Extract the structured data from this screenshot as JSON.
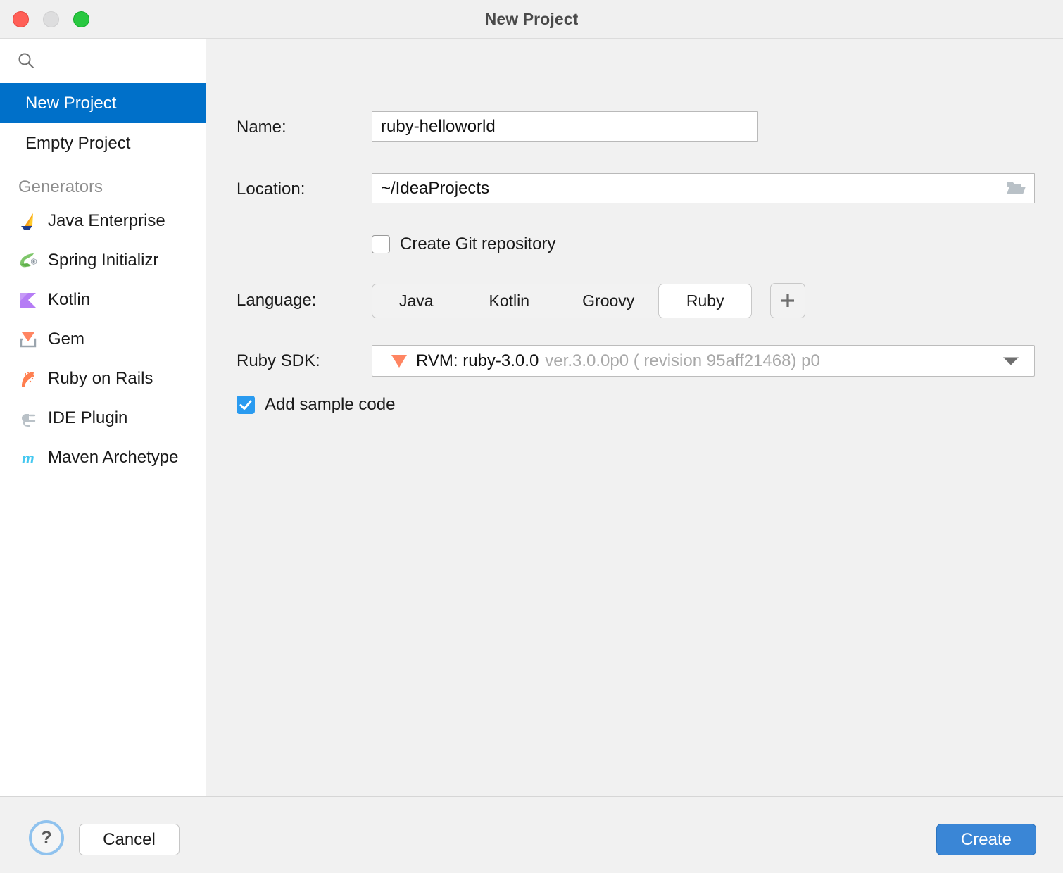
{
  "window": {
    "title": "New Project",
    "traffic_lights": [
      "close-button",
      "minimize-button",
      "zoom-button"
    ]
  },
  "sidebar": {
    "search": {
      "placeholder": "",
      "value": "",
      "icon": "search-icon"
    },
    "items": [
      {
        "label": "New Project",
        "selected": true
      },
      {
        "label": "Empty Project",
        "selected": false
      }
    ],
    "generators_title": "Generators",
    "generators": [
      {
        "label": "Java Enterprise",
        "icon": "java-enterprise-icon"
      },
      {
        "label": "Spring Initializr",
        "icon": "spring-initializr-icon"
      },
      {
        "label": "Kotlin",
        "icon": "kotlin-icon"
      },
      {
        "label": "Gem",
        "icon": "gem-icon"
      },
      {
        "label": "Ruby on Rails",
        "icon": "ruby-on-rails-icon"
      },
      {
        "label": "IDE Plugin",
        "icon": "ide-plugin-icon"
      },
      {
        "label": "Maven Archetype",
        "icon": "maven-archetype-icon"
      }
    ]
  },
  "form": {
    "name": {
      "label": "Name:",
      "value": "ruby-helloworld",
      "placeholder": ""
    },
    "location": {
      "label": "Location:",
      "value": "~/IdeaProjects",
      "placeholder": "",
      "browse_icon": "folder-icon"
    },
    "git": {
      "label": "Create Git repository",
      "checked": false
    },
    "language": {
      "label": "Language:",
      "options": [
        "Java",
        "Kotlin",
        "Groovy",
        "Ruby"
      ],
      "selected": "Ruby",
      "add_label": "+"
    },
    "sdk": {
      "label": "Ruby SDK:",
      "icon": "ruby-gem-icon",
      "value": "RVM: ruby-3.0.0",
      "detail": "ver.3.0.0p0 ( revision 95aff21468) p0"
    },
    "sample_code": {
      "label": "Add sample code",
      "checked": true
    }
  },
  "footer": {
    "help_label": "?",
    "cancel_label": "Cancel",
    "create_label": "Create"
  },
  "colors": {
    "accent": "#0070c9",
    "primary_button": "#3a86d6",
    "checkbox_checked": "#2a9bf0",
    "ruby_orange": "#ff8562"
  }
}
